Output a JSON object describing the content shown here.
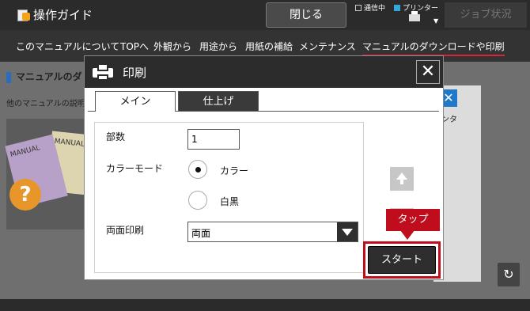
{
  "header": {
    "app_title": "操作ガイド",
    "close_label": "閉じる",
    "status_comm": "通信中",
    "status_printer": "プリンター",
    "job_status_label": "ジョブ状況"
  },
  "nav": {
    "items": [
      "このマニュアルについて",
      "TOPへ",
      "外観から",
      "用途から",
      "用紙の補給",
      "メンテナンス",
      "マニュアルのダウンロードや印刷"
    ],
    "active_index": 6
  },
  "background_page": {
    "section_title": "マニュアルのダ",
    "description": "他のマニュアルの説明",
    "manual_label_1": "MANUAL",
    "manual_label_2": "MANUAL",
    "help_symbol": "?",
    "right_label": "ンタ"
  },
  "dialog": {
    "title": "印刷",
    "tabs": [
      "メイン",
      "仕上げ"
    ],
    "active_tab": 0,
    "copies_label": "部数",
    "copies_value": "1",
    "color_mode_label": "カラーモード",
    "color_options": [
      {
        "label": "カラー",
        "selected": true
      },
      {
        "label": "白黒",
        "selected": false
      }
    ],
    "duplex_label": "両面印刷",
    "duplex_value": "両面",
    "start_label": "スタート"
  },
  "callout": {
    "label": "タップ",
    "color": "#c00d1d"
  }
}
